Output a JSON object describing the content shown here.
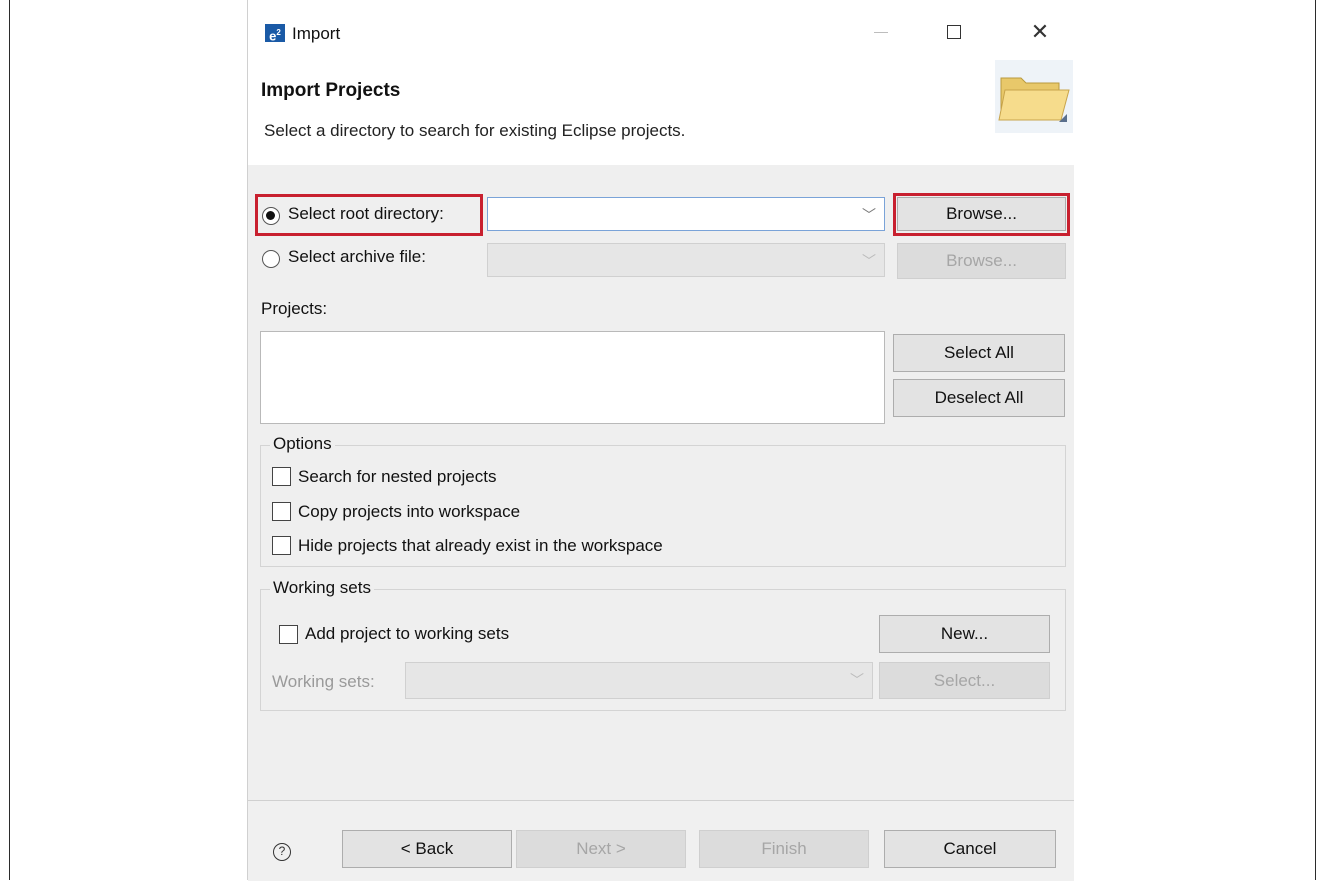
{
  "window": {
    "title": "Import",
    "logo": "e",
    "logo_sup": "2"
  },
  "header": {
    "title": "Import Projects",
    "subtitle": "Select a directory to search for existing Eclipse projects.",
    "icon": "open-folder-icon"
  },
  "source": {
    "root_dir_label": "Select root directory:",
    "root_dir_selected": true,
    "root_dir_value": "",
    "archive_label": "Select archive file:",
    "archive_selected": false,
    "browse_label": "Browse...",
    "browse_archive_label": "Browse..."
  },
  "projects": {
    "label": "Projects:",
    "items": [],
    "select_all": "Select All",
    "deselect_all": "Deselect All"
  },
  "options": {
    "legend": "Options",
    "nested": "Search for nested projects",
    "copy": "Copy projects into workspace",
    "hide": "Hide projects that already exist in the workspace"
  },
  "working_sets": {
    "legend": "Working sets",
    "add_label": "Add project to working sets",
    "new_label": "New...",
    "sets_label": "Working sets:",
    "select_label": "Select..."
  },
  "footer": {
    "help": "?",
    "back": "< Back",
    "next": "Next >",
    "finish": "Finish",
    "cancel": "Cancel"
  },
  "colors": {
    "highlight": "#c8202f",
    "accent": "#1a5aa6"
  }
}
